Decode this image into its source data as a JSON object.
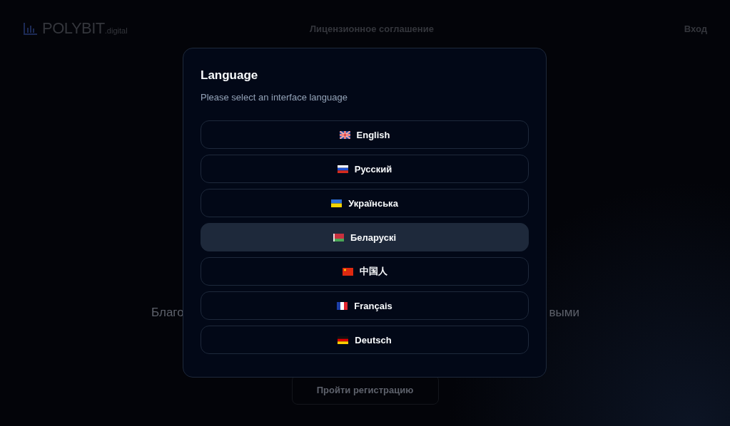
{
  "header": {
    "logo": "POLYBIT",
    "logo_suffix": ".digital",
    "nav_link": "Лицензионное соглашение",
    "login": "Вход"
  },
  "hero": {
    "text_left": "Благо",
    "text_right": "выми",
    "button": "Пройти регистрацию"
  },
  "dialog": {
    "title": "Language",
    "subtitle": "Please select an interface language",
    "languages": [
      {
        "label": "English",
        "kind": "uk",
        "selected": false
      },
      {
        "label": "Русский",
        "kind": "ru",
        "selected": false
      },
      {
        "label": "Українська",
        "kind": "ua",
        "selected": false
      },
      {
        "label": "Беларускі",
        "kind": "by",
        "selected": true
      },
      {
        "label": "中国人",
        "kind": "cn",
        "selected": false
      },
      {
        "label": "Français",
        "kind": "fr",
        "selected": false
      },
      {
        "label": "Deutsch",
        "kind": "de",
        "selected": false
      }
    ]
  }
}
